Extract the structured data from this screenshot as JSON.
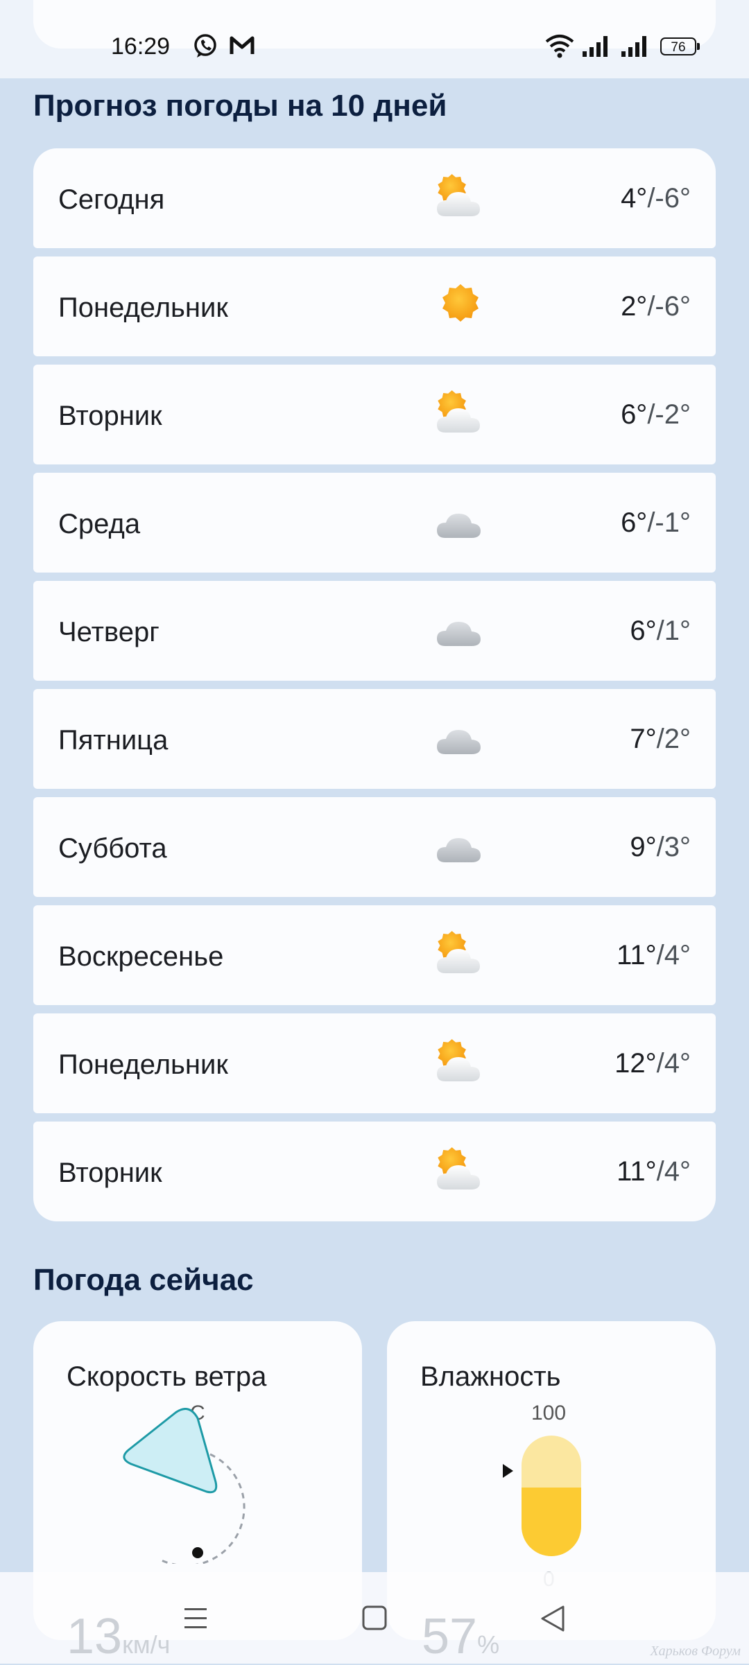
{
  "status_bar": {
    "time": "16:29",
    "battery": "76",
    "icons": [
      "viber-icon",
      "gmail-icon",
      "wifi-icon",
      "signal-icon",
      "signal-icon",
      "battery-icon"
    ]
  },
  "forecast": {
    "title": "Прогноз погоды на 10 дней",
    "days": [
      {
        "name": "Сегодня",
        "icon": "partly-cloudy",
        "high": "4°",
        "low": "/-6°"
      },
      {
        "name": "Понедельник",
        "icon": "sunny",
        "high": "2°",
        "low": "/-6°"
      },
      {
        "name": "Вторник",
        "icon": "partly-cloudy",
        "high": "6°",
        "low": "/-2°"
      },
      {
        "name": "Среда",
        "icon": "cloudy",
        "high": "6°",
        "low": "/-1°"
      },
      {
        "name": "Четверг",
        "icon": "cloudy",
        "high": "6°",
        "low": "/1°"
      },
      {
        "name": "Пятница",
        "icon": "cloudy",
        "high": "7°",
        "low": "/2°"
      },
      {
        "name": "Суббота",
        "icon": "cloudy",
        "high": "9°",
        "low": "/3°"
      },
      {
        "name": "Воскресенье",
        "icon": "partly-cloudy",
        "high": "11°",
        "low": "/4°"
      },
      {
        "name": "Понедельник",
        "icon": "partly-cloudy",
        "high": "12°",
        "low": "/4°"
      },
      {
        "name": "Вторник",
        "icon": "partly-cloudy",
        "high": "11°",
        "low": "/4°"
      }
    ]
  },
  "now": {
    "title": "Погода сейчас",
    "wind": {
      "title": "Скорость ветра",
      "direction_label": "С",
      "value": "13",
      "unit": "км/ч"
    },
    "humidity": {
      "title": "Влажность",
      "max_label": "100",
      "min_label": "0",
      "value": "57",
      "unit": "%",
      "level": 0.57
    }
  },
  "colors": {
    "background": "#d0dff0",
    "card": "#fbfcfe",
    "accent_yellow": "#fccb33",
    "wind_fill": "#cdeef5"
  },
  "watermark": "Харьков Форум"
}
